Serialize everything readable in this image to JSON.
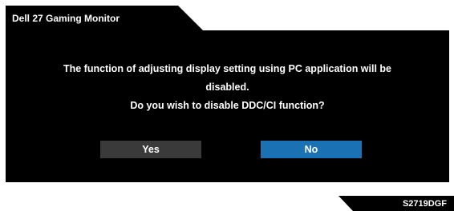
{
  "window": {
    "title": "Dell 27 Gaming Monitor"
  },
  "dialog": {
    "message_lines": [
      "The function of adjusting display setting using PC application will be",
      "disabled.",
      "Do you wish to disable DDC/CI function?"
    ],
    "buttons": {
      "yes_label": "Yes",
      "no_label": "No"
    },
    "selected_button": "No"
  },
  "footer": {
    "model": "S2719DGF"
  },
  "colors": {
    "background": "#000000",
    "text": "#ffffff",
    "button_default": "#3a3a3a",
    "button_selected": "#1a72b5"
  }
}
